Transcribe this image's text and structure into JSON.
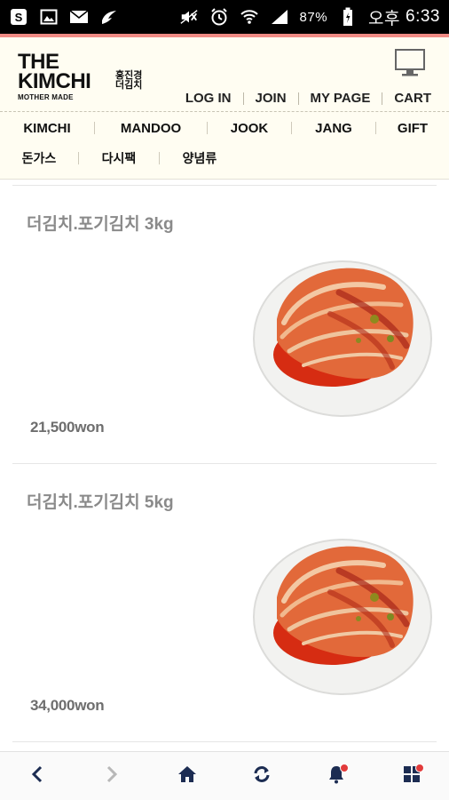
{
  "status_bar": {
    "battery": "87%",
    "ampm": "오후",
    "time": "6:33"
  },
  "brand": {
    "line1": "THE",
    "line2": "KIMCHI",
    "tagline": "MOTHER MADE",
    "korean": "홍진경 더김치"
  },
  "top_links": [
    "LOG IN",
    "JOIN",
    "MY PAGE",
    "CART"
  ],
  "categories": [
    "KIMCHI",
    "MANDOO",
    "JOOK",
    "JANG",
    "GIFT"
  ],
  "categories2": [
    "돈가스",
    "다시팩",
    "양념류"
  ],
  "products": [
    {
      "name": "더김치.포기김치 3kg",
      "price": "21,500won"
    },
    {
      "name": "더김치.포기김치 5kg",
      "price": "34,000won"
    }
  ],
  "colors": {
    "accent": "#f08a84",
    "header_bg": "#fffdf2",
    "icon_navy": "#1c2c52",
    "badge_red": "#e23b3b"
  },
  "icons": {
    "toolbar": [
      "back-icon",
      "forward-icon",
      "home-icon",
      "refresh-icon",
      "bell-icon",
      "apps-grid-icon"
    ]
  }
}
